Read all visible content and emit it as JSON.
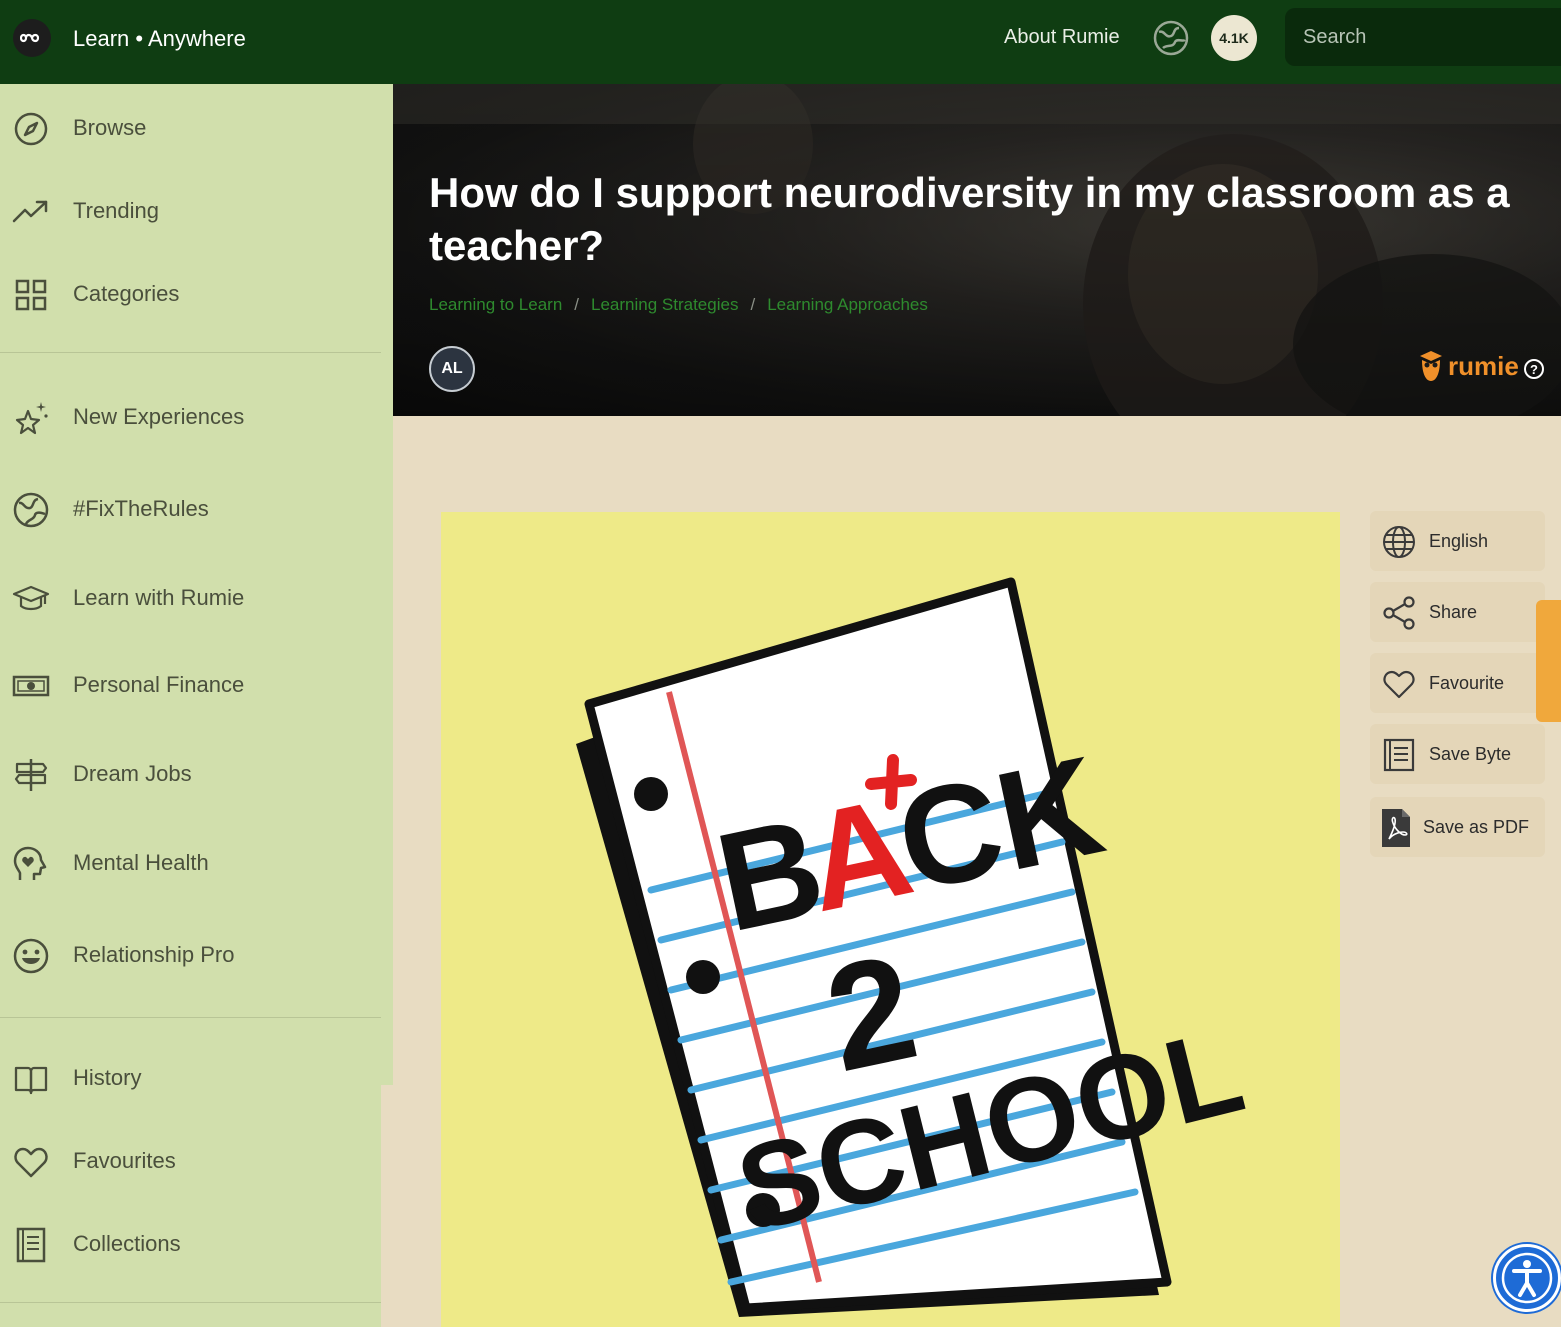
{
  "header": {
    "brand": "Learn • Anywhere",
    "about_link": "About Rumie",
    "badge_count": "4.1K",
    "search_placeholder": "Search"
  },
  "sidebar": {
    "items": [
      {
        "label": "Browse",
        "icon": "compass-icon"
      },
      {
        "label": "Trending",
        "icon": "trending-icon"
      },
      {
        "label": "Categories",
        "icon": "grid-icon"
      },
      {
        "label": "New Experiences",
        "icon": "sparkle-star-icon"
      },
      {
        "label": "#FixTheRules",
        "icon": "globe-icon"
      },
      {
        "label": "Learn with Rumie",
        "icon": "graduation-cap-icon"
      },
      {
        "label": "Personal Finance",
        "icon": "banknote-icon"
      },
      {
        "label": "Dream Jobs",
        "icon": "signpost-icon"
      },
      {
        "label": "Mental Health",
        "icon": "head-heart-icon"
      },
      {
        "label": "Relationship Pro",
        "icon": "smiley-icon"
      },
      {
        "label": "History",
        "icon": "book-open-icon"
      },
      {
        "label": "Favourites",
        "icon": "heart-icon"
      },
      {
        "label": "Collections",
        "icon": "collection-icon"
      }
    ]
  },
  "hero": {
    "title": "How do I support neurodiversity in my classroom as a teacher?",
    "breadcrumbs": [
      "Learning to Learn",
      "Learning Strategies",
      "Learning Approaches"
    ],
    "author_initials": "AL",
    "publisher": "rumie"
  },
  "image": {
    "words": [
      "B",
      "A",
      "CK",
      "2",
      "SCHOOL"
    ]
  },
  "actions": [
    {
      "label": "English",
      "icon": "globe-icon"
    },
    {
      "label": "Share",
      "icon": "share-icon"
    },
    {
      "label": "Favourite",
      "icon": "heart-icon"
    },
    {
      "label": "Save Byte",
      "icon": "notebook-icon"
    },
    {
      "label": "Save as PDF",
      "icon": "pdf-icon"
    }
  ],
  "colors": {
    "header_bg": "#0f3d12",
    "sidebar_bg": "#d1dfac",
    "page_bg": "#e8dcc2",
    "breadcrumb": "#2e8a2e",
    "brand_orange": "#f0902a",
    "image_bg": "#eeea88"
  }
}
